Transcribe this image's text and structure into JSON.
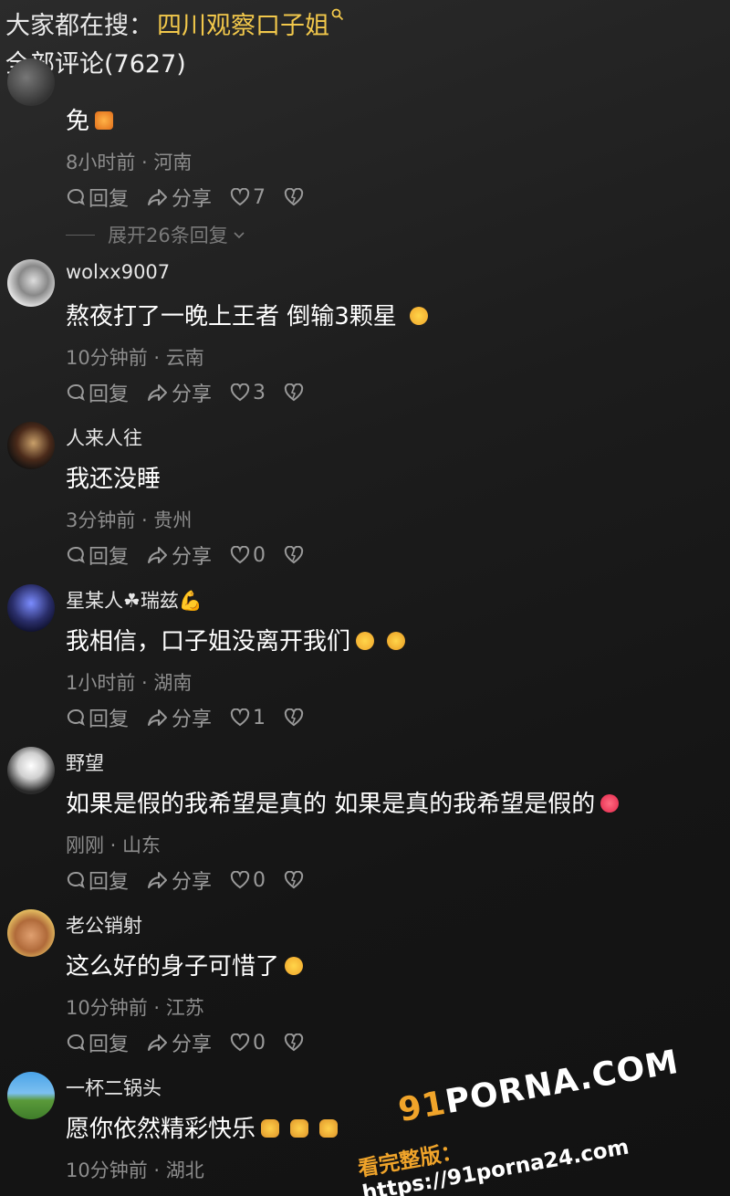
{
  "search": {
    "label": "大家都在搜：",
    "term": "四川观察口子姐"
  },
  "comments_header": {
    "text": "全部评论(7627)"
  },
  "action_labels": {
    "reply": "回复",
    "share": "分享"
  },
  "comments": [
    {
      "user": "",
      "text": "免",
      "time": "8小时前 · 河南",
      "likes": "7",
      "expand": "展开26条回复"
    },
    {
      "user": "wolxx9007",
      "text": "熬夜打了一晚上王者 倒输3颗星",
      "time": "10分钟前 · 云南",
      "likes": "3"
    },
    {
      "user": "人来人往",
      "text": "我还没睡",
      "time": "3分钟前 · 贵州",
      "likes": "0"
    },
    {
      "user": "星某人☘瑞兹💪",
      "text": "我相信，口子姐没离开我们",
      "time": "1小时前 · 湖南",
      "likes": "1"
    },
    {
      "user": "野望",
      "text": "如果是假的我希望是真的 如果是真的我希望是假的",
      "time": "刚刚 · 山东",
      "likes": "0"
    },
    {
      "user": "老公销射",
      "text": "这么好的身子可惜了",
      "time": "10分钟前 · 江苏",
      "likes": "0"
    },
    {
      "user": "一杯二锅头",
      "text": "愿你依然精彩快乐",
      "time": "10分钟前 · 湖北",
      "likes": ""
    }
  ],
  "watermark": {
    "brand_prefix": "91",
    "brand_suffix": "PORNA.COM",
    "label": "看完整版：",
    "url": "https://91porna24.com"
  },
  "colors": {
    "accent": "#f2c84b",
    "muted": "#8d8d8d",
    "like_heart": "#ff3b5c"
  },
  "icons": [
    "search-icon",
    "reply-icon",
    "share-icon",
    "like-icon",
    "dislike-icon",
    "chevron-down-icon"
  ]
}
